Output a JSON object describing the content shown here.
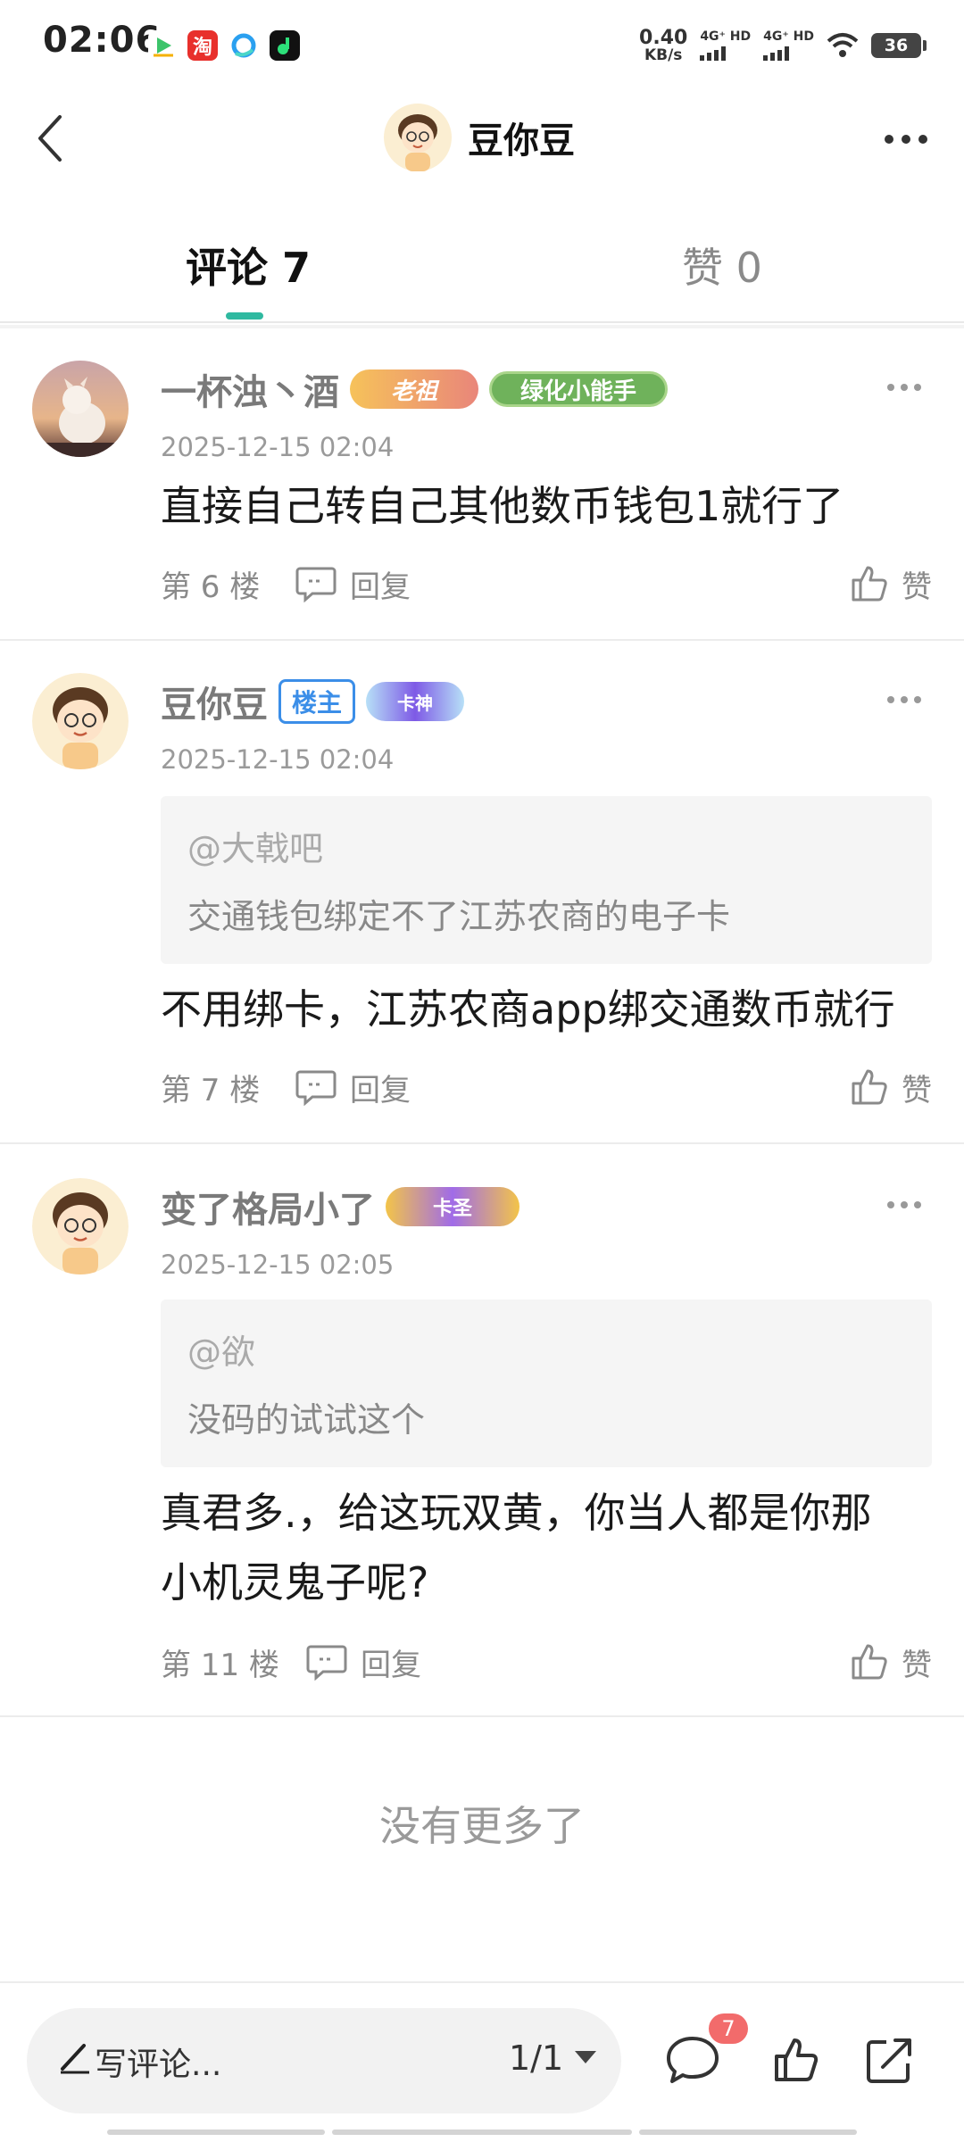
{
  "status_bar": {
    "time": "02:06",
    "net_speed_value": "0.40",
    "net_speed_unit": "KB/s",
    "sim1": "4G⁺ HD",
    "sim2": "4G⁺ HD",
    "battery": "36",
    "app_icons": [
      "tv-app-icon",
      "taobao-icon",
      "browser-icon",
      "music-app-icon"
    ],
    "taobao_label": "淘"
  },
  "header": {
    "title": "豆你豆",
    "back_icon": "chevron-left-icon",
    "more_icon": "more-horizontal-icon"
  },
  "tabs": {
    "comments": "评论 7",
    "likes": "赞 0",
    "accent": "#2fb9a0"
  },
  "comments": [
    {
      "name": "一杯浊丶酒",
      "badges": [
        {
          "text": "老祖",
          "style": "laozu"
        },
        {
          "text": "绿化小能手",
          "style": "green"
        }
      ],
      "time": "2025-12-15 02:04",
      "text": "直接自己转自己其他数币钱包1就行了",
      "floor": "第 6 楼",
      "reply": "回复",
      "like": "赞"
    },
    {
      "name": "豆你豆",
      "badges": [
        {
          "text": "楼主",
          "style": "louzhu"
        },
        {
          "text": "卡神",
          "style": "kashen"
        }
      ],
      "time": "2025-12-15 02:04",
      "quote_user": "@大戟吧",
      "quote_text": "交通钱包绑定不了江苏农商的电子卡",
      "text": "不用绑卡，江苏农商app绑交通数币就行",
      "floor": "第 7 楼",
      "reply": "回复",
      "like": "赞"
    },
    {
      "name": "变了格局小了",
      "badges": [
        {
          "text": "卡圣",
          "style": "kasheng"
        }
      ],
      "time": "2025-12-15 02:05",
      "quote_user": "@欲",
      "quote_text": "没码的试试这个",
      "text_line1": "真君多.，给这玩双黄，你当人都是你那",
      "text_line2": "小机灵鬼子呢?",
      "floor": "第 11 楼",
      "reply": "回复",
      "like": "赞"
    }
  ],
  "no_more": "没有更多了",
  "bottom_bar": {
    "placeholder": "写评论...",
    "page": "1/1",
    "comment_count_badge": "7",
    "comment_icon": "speech-bubble-icon",
    "like_icon": "thumbs-up-icon",
    "share_icon": "share-icon"
  }
}
